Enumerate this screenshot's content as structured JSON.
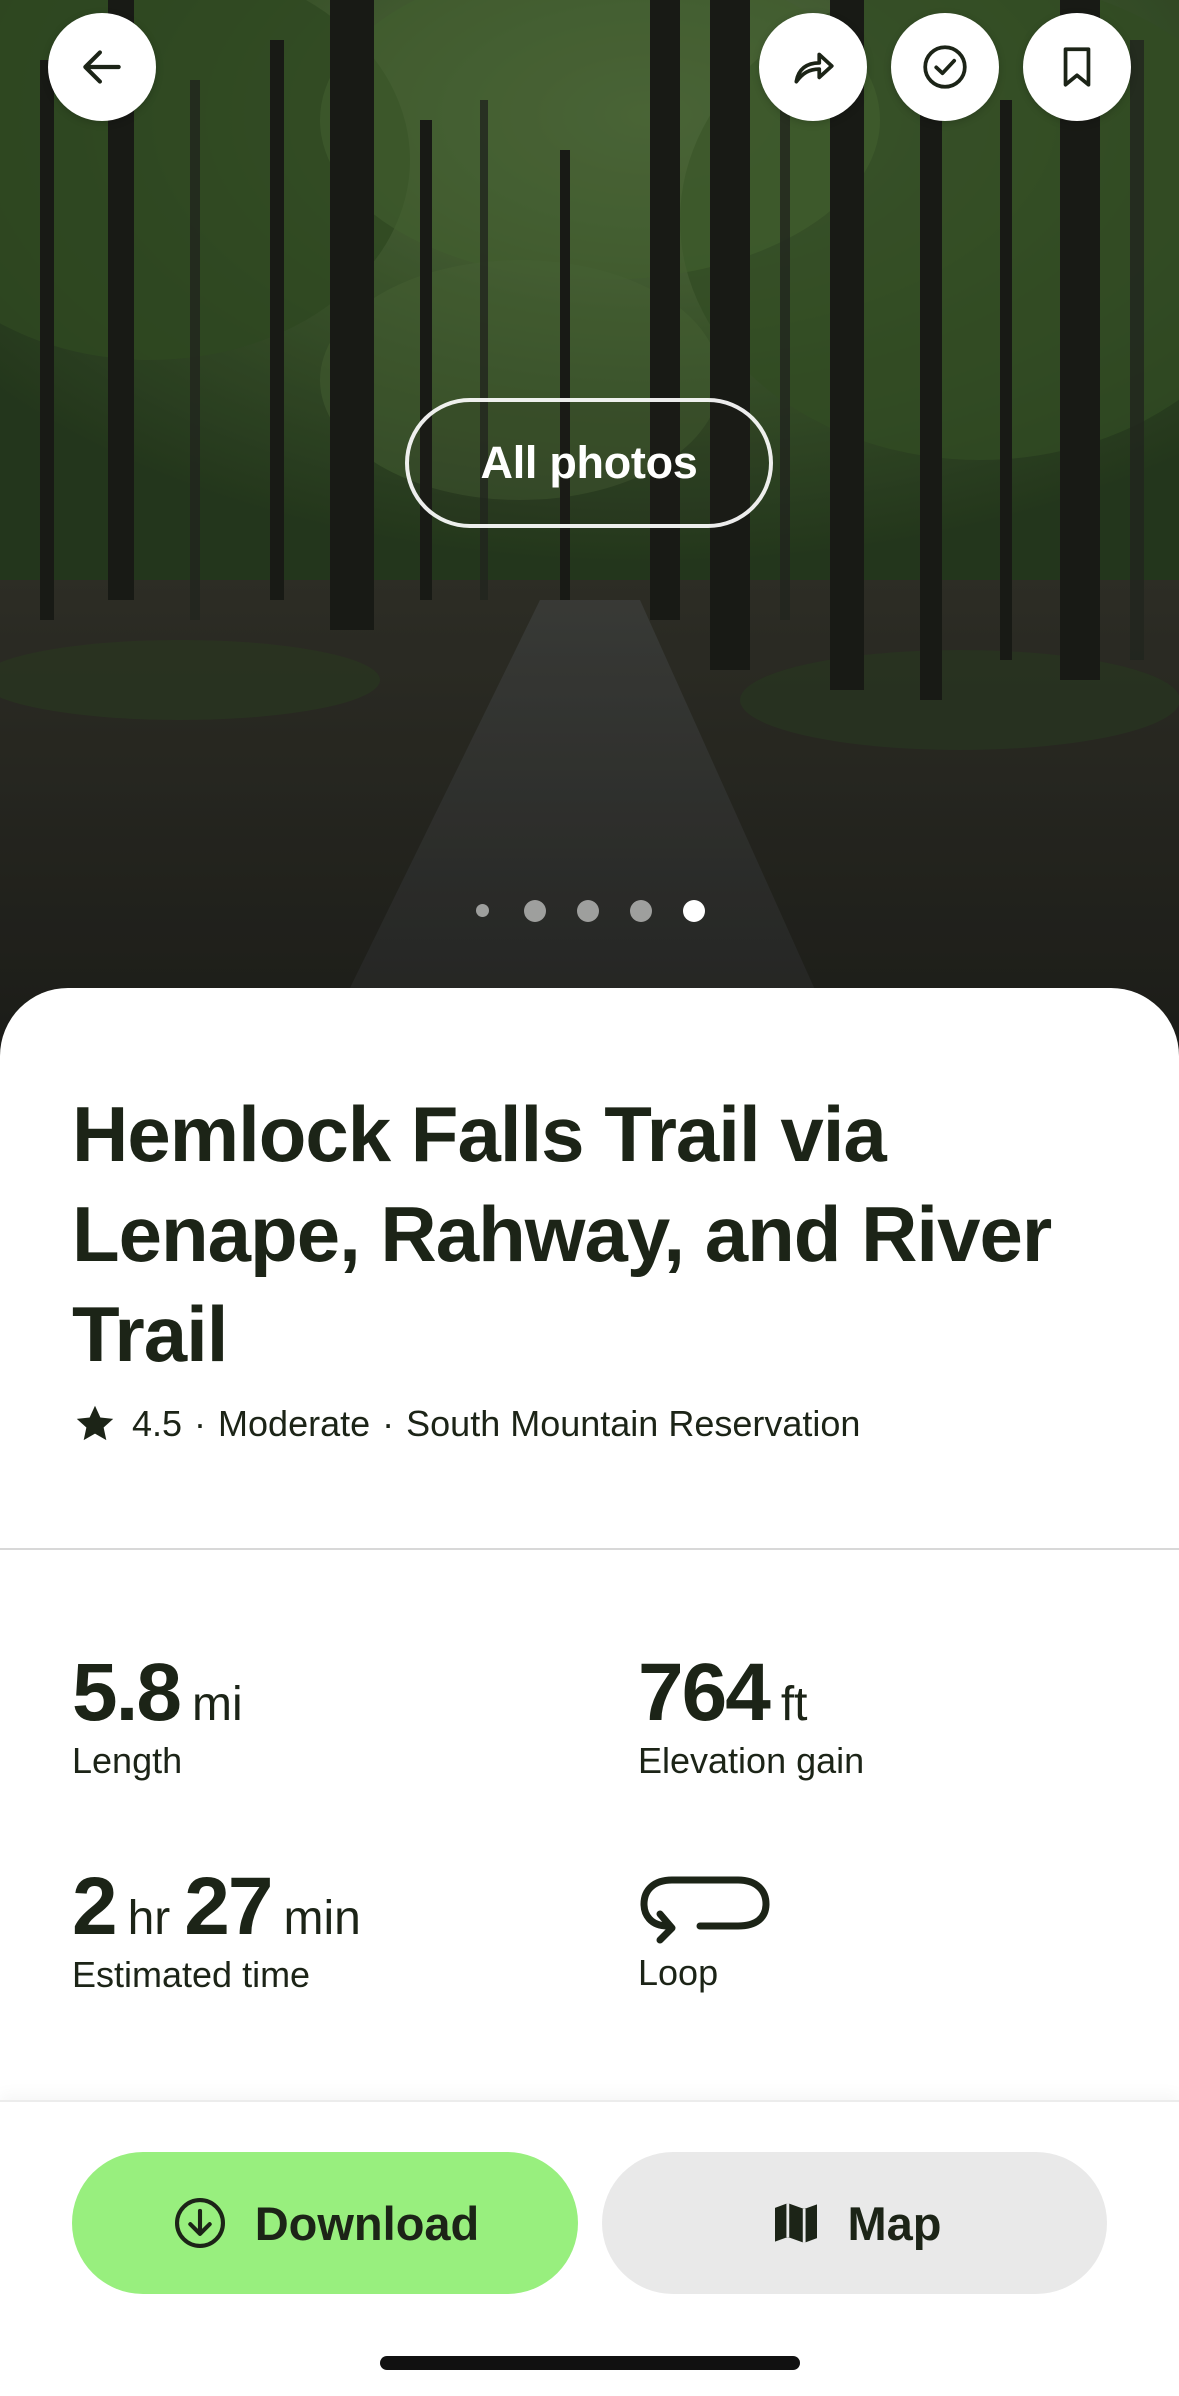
{
  "hero": {
    "all_photos_label": "All photos",
    "photo_count": 5,
    "active_photo_index": 4
  },
  "toolbar": {
    "back_icon": "arrow-left-icon",
    "share_icon": "share-arrow-icon",
    "complete_icon": "check-circle-icon",
    "save_icon": "bookmark-icon"
  },
  "trail": {
    "title": "Hemlock Falls Trail via Lenape, Rahway, and River Trail",
    "rating": "4.5",
    "separator": "·",
    "difficulty": "Moderate",
    "park": "South Mountain Reservation"
  },
  "stats": {
    "length": {
      "value": "5.8",
      "unit": "mi",
      "label": "Length"
    },
    "elevation": {
      "value": "764",
      "unit": "ft",
      "label": "Elevation gain"
    },
    "time": {
      "hours": "2",
      "hours_unit": "hr",
      "minutes": "27",
      "minutes_unit": "min",
      "label": "Estimated time"
    },
    "route": {
      "icon": "loop-route-icon",
      "label": "Loop"
    }
  },
  "actions": {
    "download_label": "Download",
    "map_label": "Map"
  },
  "colors": {
    "accent_green": "#98ef7e",
    "text_dark": "#1c2417",
    "map_button_bg": "#e9e9e9"
  }
}
